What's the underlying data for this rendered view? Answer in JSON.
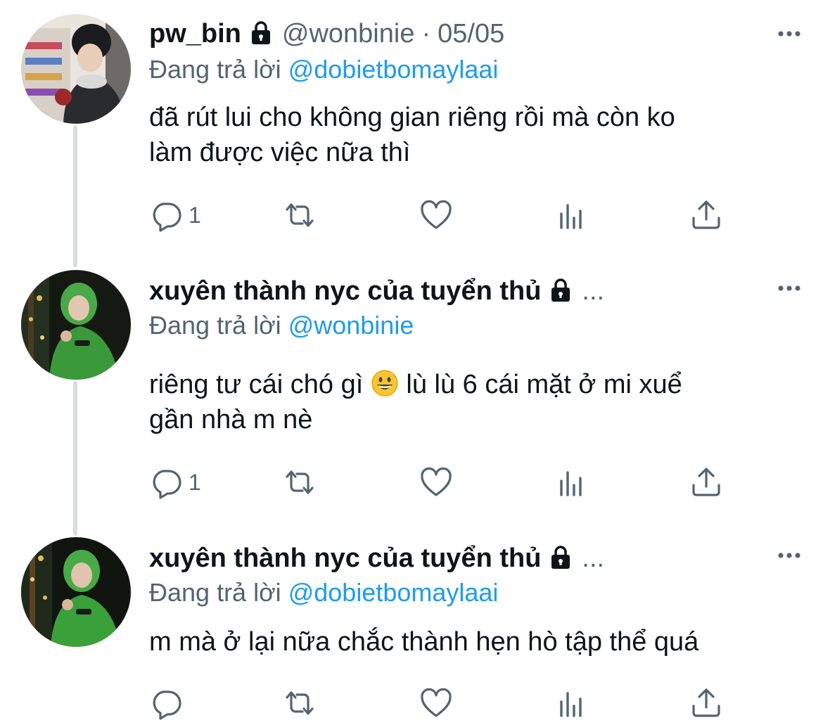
{
  "replies": [
    {
      "name": "pw_bin",
      "handle": "@wonbinie",
      "separator": "·",
      "date": "05/05",
      "reply_prefix": "Đang trả lời",
      "reply_to": "@dobietbomaylaai",
      "text_lines": [
        "đã rút lui cho không gian riêng rồi mà còn ko",
        "làm được việc nữa thì"
      ],
      "reply_count": "1"
    },
    {
      "name": "xuyên thành nyc của tuyển thủ",
      "truncation": "...",
      "reply_prefix": "Đang trả lời",
      "reply_to": "@wonbinie",
      "text_part1": "riêng tư cái chó gì",
      "text_part2": " lù lù 6 cái mặt ở mi xuể",
      "text_line2": "gần nhà m nè",
      "reply_count": "1"
    },
    {
      "name": "xuyên thành nyc của tuyển thủ",
      "truncation": "...",
      "reply_prefix": "Đang trả lời",
      "reply_to": "@dobietbomaylaai",
      "text_lines": [
        "m mà ở lại nữa chắc thành hẹn hò tập thể quá"
      ],
      "reply_count": ""
    }
  ],
  "icons": {
    "lock": "lock-icon",
    "more": "more-horizontal-icon",
    "reply": "reply-icon",
    "retweet": "retweet-icon",
    "like": "heart-icon",
    "analytics": "analytics-icon",
    "share": "share-icon",
    "emoji": "grinning-face-emoji"
  },
  "colors": {
    "text": "#0f1419",
    "secondary": "#536471",
    "link": "#1d9bf0",
    "thread_line": "#d9dde0"
  }
}
